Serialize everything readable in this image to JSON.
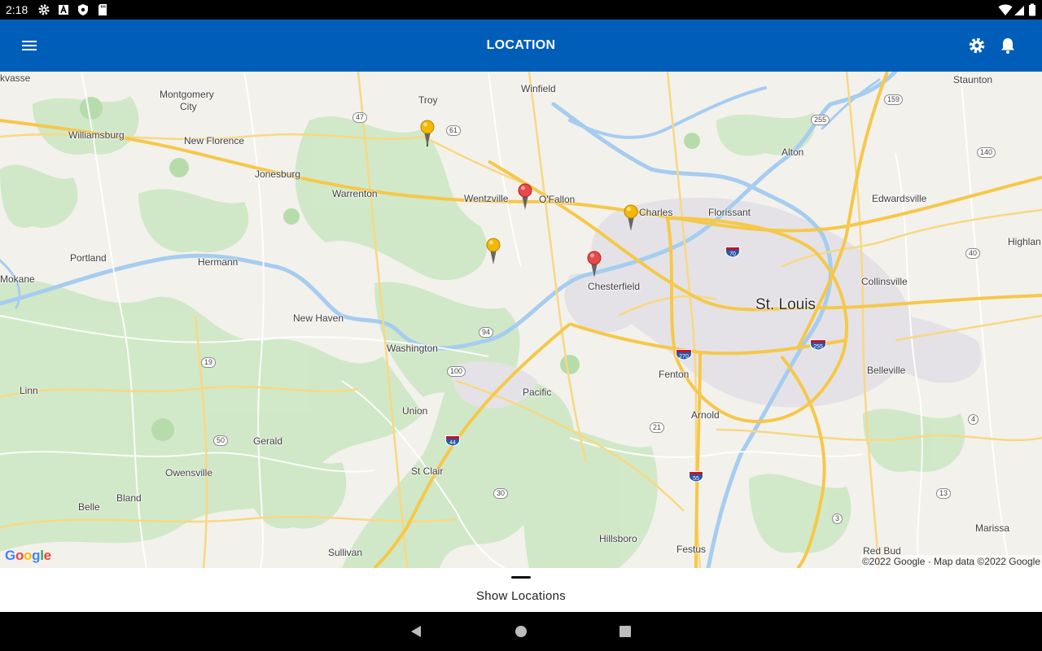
{
  "status_bar": {
    "time": "2:18",
    "left_icons": [
      "gear-icon",
      "a-icon",
      "shield-icon",
      "sd-card-icon"
    ],
    "right_icons": [
      "wifi-icon",
      "signal-icon",
      "battery-icon"
    ]
  },
  "app_bar": {
    "title": "LOCATION",
    "menu_icon": "hamburger-menu-icon",
    "settings_icon": "gear-icon",
    "notifications_icon": "bell-icon",
    "color": "#005eb8"
  },
  "map": {
    "cities": {
      "kvasse": "kvasse",
      "montgomery": "Montgomery",
      "city": "City",
      "troy": "Troy",
      "winfield": "Winfield",
      "staunton": "Staunton",
      "williamsburg": "Williamsburg",
      "new_florence": "New Florence",
      "alton": "Alton",
      "jonesburg": "Jonesburg",
      "warrenton": "Warrenton",
      "wentzville": "Wentzville",
      "ofallon": "O'Fallon",
      "edwardsville": "Edwardsville",
      "charles": "Charles",
      "florissant": "Florissant",
      "highland": "Highlan",
      "portland": "Portland",
      "hermann": "Hermann",
      "mokane": "Mokane",
      "chesterfield": "Chesterfield",
      "collinsville": "Collinsville",
      "st_louis": "St. Louis",
      "new_haven": "New Haven",
      "washington": "Washington",
      "fenton": "Fenton",
      "belleville": "Belleville",
      "linn": "Linn",
      "pacific": "Pacific",
      "union": "Union",
      "arnold": "Arnold",
      "gerald": "Gerald",
      "owensville": "Owensville",
      "st_clair": "St Clair",
      "bland": "Bland",
      "belle": "Belle",
      "hillsboro": "Hillsboro",
      "marissa": "Marissa",
      "festus": "Festus",
      "red_bud": "Red Bud",
      "sullivan": "Sullivan"
    },
    "highway_shields": {
      "r47": "47",
      "r61": "61",
      "r159": "159",
      "r255": "255",
      "r140": "140",
      "r70": "70",
      "r40": "40",
      "r94": "94",
      "r270": "270",
      "r255b": "255",
      "r19": "19",
      "r100": "100",
      "r4": "4",
      "r21": "21",
      "r50": "50",
      "r44": "44",
      "r55": "55",
      "r30": "30",
      "r13": "13",
      "r3": "3"
    },
    "pins": [
      {
        "name": "Troy",
        "color": "yellow"
      },
      {
        "name": "O'Fallon",
        "color": "red"
      },
      {
        "name": "St. Charles",
        "color": "yellow"
      },
      {
        "name": "Wentzville South",
        "color": "yellow"
      },
      {
        "name": "Chesterfield",
        "color": "red"
      }
    ],
    "pin_colors": {
      "yellow": "#f5b800",
      "red": "#e8494a"
    },
    "google_logo": "Google",
    "attribution": "©2022 Google · Map data ©2022 Google"
  },
  "sheet": {
    "label": "Show Locations"
  },
  "nav_bar": {
    "back_icon": "back-triangle-icon",
    "home_icon": "home-circle-icon",
    "recents_icon": "recents-square-icon"
  }
}
